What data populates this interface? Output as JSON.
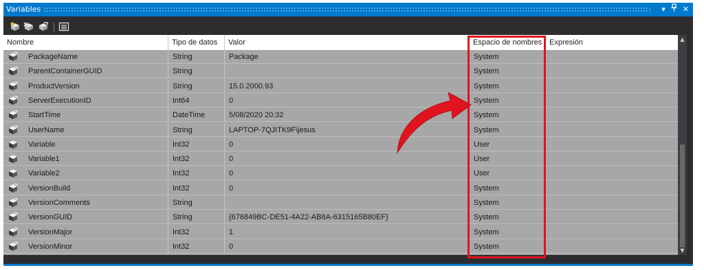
{
  "window": {
    "title": "Variables",
    "controls": {
      "dropdown": "▾",
      "pin": "ḣ",
      "close": "✕"
    }
  },
  "toolbar": {
    "buttons": [
      {
        "name": "add-variable-icon"
      },
      {
        "name": "delete-variable-icon"
      },
      {
        "name": "move-variable-icon"
      },
      {
        "name": "grid-options-icon"
      }
    ]
  },
  "grid": {
    "columns": [
      "Nombre",
      "Tipo de datos",
      "Valor",
      "Espacio de nombres",
      "Expresión"
    ],
    "rows": [
      {
        "name": "PackageName",
        "type": "String",
        "value": "Package",
        "namespace": "System",
        "expression": ""
      },
      {
        "name": "ParentContainerGUID",
        "type": "String",
        "value": "",
        "namespace": "System",
        "expression": ""
      },
      {
        "name": "ProductVersion",
        "type": "String",
        "value": "15.0.2000.93",
        "namespace": "System",
        "expression": ""
      },
      {
        "name": "ServerExecutionID",
        "type": "Int64",
        "value": "0",
        "namespace": "System",
        "expression": ""
      },
      {
        "name": "StartTime",
        "type": "DateTime",
        "value": "5/08/2020 20:32",
        "namespace": "System",
        "expression": ""
      },
      {
        "name": "UserName",
        "type": "String",
        "value": "LAPTOP-7QJITK9F\\jesus",
        "namespace": "System",
        "expression": ""
      },
      {
        "name": "Variable",
        "type": "Int32",
        "value": "0",
        "namespace": "User",
        "expression": ""
      },
      {
        "name": "Variable1",
        "type": "Int32",
        "value": "0",
        "namespace": "User",
        "expression": ""
      },
      {
        "name": "Variable2",
        "type": "Int32",
        "value": "0",
        "namespace": "User",
        "expression": ""
      },
      {
        "name": "VersionBuild",
        "type": "Int32",
        "value": "0",
        "namespace": "System",
        "expression": ""
      },
      {
        "name": "VersionComments",
        "type": "String",
        "value": "",
        "namespace": "System",
        "expression": ""
      },
      {
        "name": "VersionGUID",
        "type": "String",
        "value": "{676849BC-DE51-4A22-AB8A-6315165B80EF}",
        "namespace": "System",
        "expression": ""
      },
      {
        "name": "VersionMajor",
        "type": "Int32",
        "value": "1",
        "namespace": "System",
        "expression": ""
      },
      {
        "name": "VersionMinor",
        "type": "Int32",
        "value": "0",
        "namespace": "System",
        "expression": ""
      }
    ]
  },
  "colors": {
    "accent": "#007acc",
    "highlight": "#e0141e",
    "row_background": "#a7a7a7"
  }
}
